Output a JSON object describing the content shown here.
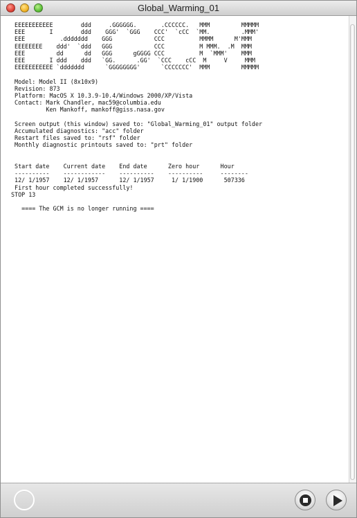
{
  "window": {
    "title": "Global_Warming_01"
  },
  "console": {
    "banner": [
      " EEEEEEEEEEE        ddd     .GGGGGG.       .CCCCCC.   MMM         MMMMM",
      " EEE       I        ddd    GGG'  `GGG    CCC'  `cCC  `MM.         .MMM'",
      " EEE          .ddddddd    GGG            CCC          MMMM      M'MMM",
      " EEEEEEEE    ddd'  `ddd   GGG            CCC          M MMM.  .M  MMM",
      " EEE         dd      dd   GGG      gGGGG CCC          M  `MMM'    MMM",
      " EEE       I ddd    ddd   `GG.      .GG'  `CCC    cCC  M     V     MMM",
      " EEEEEEEEEEE `ddddddd      `GGGGGGGG'      `CCCCCCC'  MMM         MMMMM"
    ],
    "model": " Model: Model II (8x10x9)",
    "revision": " Revision: 873",
    "platform": " Platform: MacOS X 10.3.9-10.4/Windows 2000/XP/Vista",
    "contact1": " Contact: Mark Chandler, mac59@columbia.edu",
    "contact2": "          Ken Mankoff, mankoff@giss.nasa.gov",
    "output1": " Screen output (this window) saved to: \"Global_Warming_01\" output folder",
    "output2": " Accumulated diagnostics: \"acc\" folder",
    "output3": " Restart files saved to: \"rsf\" folder",
    "output4": " Monthly diagnostic printouts saved to: \"prt\" folder",
    "table_header": " Start date    Current date    End date      Zero hour      Hour",
    "table_rule": " ----------    ------------    ----------    ----------     --------",
    "table_row": " 12/ 1/1957    12/ 1/1957      12/ 1/1957     1/ 1/1900      507336",
    "first_hour": " First hour completed successfully!",
    "stop": "STOP 13",
    "gcm_status": "   ==== The GCM is no longer running ===="
  }
}
